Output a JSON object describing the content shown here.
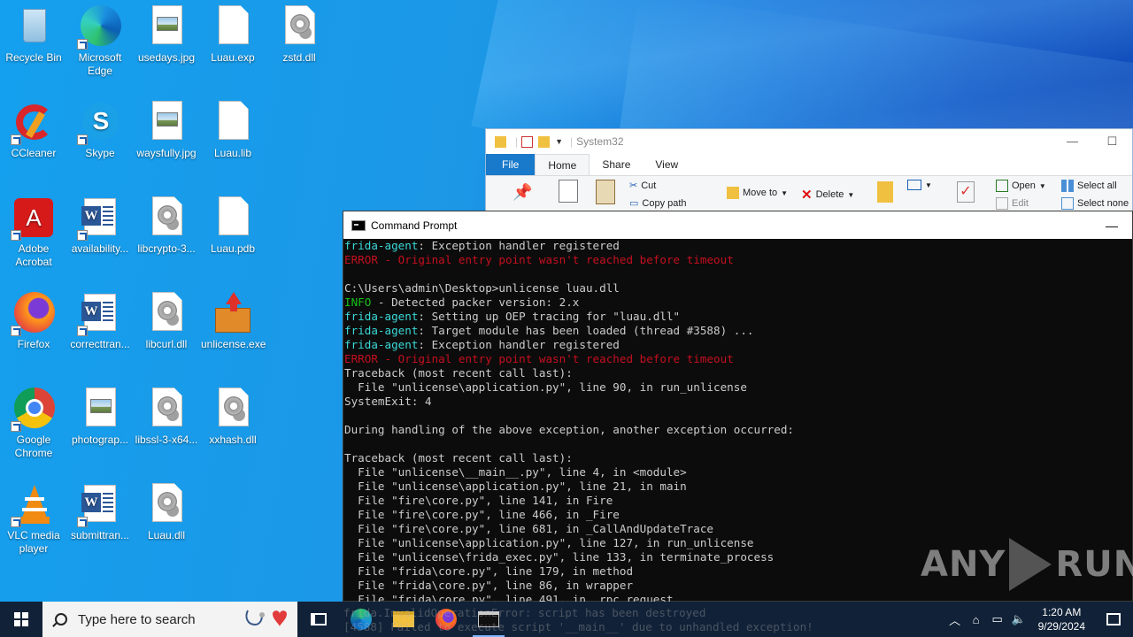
{
  "desktop": {
    "icons": [
      {
        "label": "Recycle Bin",
        "icon": "recycle-bin-icon"
      },
      {
        "label": "Microsoft Edge",
        "icon": "edge-icon"
      },
      {
        "label": "usedays.jpg",
        "icon": "image-file-icon"
      },
      {
        "label": "Luau.exp",
        "icon": "blank-file-icon"
      },
      {
        "label": "zstd.dll",
        "icon": "dll-file-icon"
      },
      {
        "label": "CCleaner",
        "icon": "ccleaner-icon"
      },
      {
        "label": "Skype",
        "icon": "skype-icon"
      },
      {
        "label": "waysfully.jpg",
        "icon": "image-file-icon"
      },
      {
        "label": "Luau.lib",
        "icon": "blank-file-icon"
      },
      {
        "label": "Adobe Acrobat",
        "icon": "acrobat-icon"
      },
      {
        "label": "availability...",
        "icon": "word-doc-icon"
      },
      {
        "label": "libcrypto-3...",
        "icon": "dll-file-icon"
      },
      {
        "label": "Luau.pdb",
        "icon": "blank-file-icon"
      },
      {
        "label": "Firefox",
        "icon": "firefox-icon"
      },
      {
        "label": "correcttran...",
        "icon": "word-doc-icon"
      },
      {
        "label": "libcurl.dll",
        "icon": "dll-file-icon"
      },
      {
        "label": "unlicense.exe",
        "icon": "installer-box-icon"
      },
      {
        "label": "Google Chrome",
        "icon": "chrome-icon"
      },
      {
        "label": "photograp...",
        "icon": "image-file-icon"
      },
      {
        "label": "libssl-3-x64...",
        "icon": "dll-file-icon"
      },
      {
        "label": "xxhash.dll",
        "icon": "dll-file-icon"
      },
      {
        "label": "VLC media player",
        "icon": "vlc-icon"
      },
      {
        "label": "submittran...",
        "icon": "word-doc-icon"
      },
      {
        "label": "Luau.dll",
        "icon": "dll-file-icon"
      }
    ]
  },
  "explorer": {
    "title": "System32",
    "tabs": [
      "File",
      "Home",
      "Share",
      "View"
    ],
    "active_tab": "Home",
    "ribbon": {
      "cut": "Cut",
      "copy_path": "Copy path",
      "move_to": "Move to",
      "delete": "Delete",
      "open": "Open",
      "edit": "Edit",
      "select_all": "Select all",
      "select_none": "Select none"
    },
    "minimize": "—",
    "maximize": "☐"
  },
  "cmd": {
    "title": "Command Prompt",
    "minimize": "—",
    "lines": [
      {
        "prefix": "frida-agent",
        "prefix_color": "cyan",
        "text": ": Exception handler registered"
      },
      {
        "prefix": "ERROR",
        "prefix_color": "red",
        "text": " - Original entry point wasn't reached before timeout",
        "text_color": "red"
      },
      {
        "prefix": "",
        "text": ""
      },
      {
        "prefix": "",
        "text": "C:\\Users\\admin\\Desktop>unlicense luau.dll"
      },
      {
        "prefix": "INFO",
        "prefix_color": "green",
        "text": " - Detected packer version: 2.x"
      },
      {
        "prefix": "frida-agent",
        "prefix_color": "cyan",
        "text": ": Setting up OEP tracing for \"luau.dll\""
      },
      {
        "prefix": "frida-agent",
        "prefix_color": "cyan",
        "text": ": Target module has been loaded (thread #3588) ..."
      },
      {
        "prefix": "frida-agent",
        "prefix_color": "cyan",
        "text": ": Exception handler registered"
      },
      {
        "prefix": "ERROR",
        "prefix_color": "red",
        "text": " - Original entry point wasn't reached before timeout",
        "text_color": "red"
      },
      {
        "prefix": "",
        "text": "Traceback (most recent call last):"
      },
      {
        "prefix": "",
        "text": "  File \"unlicense\\application.py\", line 90, in run_unlicense"
      },
      {
        "prefix": "",
        "text": "SystemExit: 4"
      },
      {
        "prefix": "",
        "text": ""
      },
      {
        "prefix": "",
        "text": "During handling of the above exception, another exception occurred:"
      },
      {
        "prefix": "",
        "text": ""
      },
      {
        "prefix": "",
        "text": "Traceback (most recent call last):"
      },
      {
        "prefix": "",
        "text": "  File \"unlicense\\__main__.py\", line 4, in <module>"
      },
      {
        "prefix": "",
        "text": "  File \"unlicense\\application.py\", line 21, in main"
      },
      {
        "prefix": "",
        "text": "  File \"fire\\core.py\", line 141, in Fire"
      },
      {
        "prefix": "",
        "text": "  File \"fire\\core.py\", line 466, in _Fire"
      },
      {
        "prefix": "",
        "text": "  File \"fire\\core.py\", line 681, in _CallAndUpdateTrace"
      },
      {
        "prefix": "",
        "text": "  File \"unlicense\\application.py\", line 127, in run_unlicense"
      },
      {
        "prefix": "",
        "text": "  File \"unlicense\\frida_exec.py\", line 133, in terminate_process"
      },
      {
        "prefix": "",
        "text": "  File \"frida\\core.py\", line 179, in method"
      },
      {
        "prefix": "",
        "text": "  File \"frida\\core.py\", line 86, in wrapper"
      },
      {
        "prefix": "",
        "text": "  File \"frida\\core.py\", line 491, in _rpc_request"
      }
    ],
    "overlay_lines": [
      "frida.InvalidOperationError: script has been destroyed",
      "[4588] Failed to execute script '__main__' due to unhandled exception!"
    ]
  },
  "watermark": {
    "left": "ANY",
    "right": "RUN"
  },
  "taskbar": {
    "search_placeholder": "Type here to search",
    "time": "1:20 AM",
    "date": "9/29/2024"
  },
  "colors": {
    "cyan": "#3ad7d7",
    "red": "#c50f1f",
    "green": "#13c113",
    "ribbon_file_tab": "#1979ca"
  }
}
